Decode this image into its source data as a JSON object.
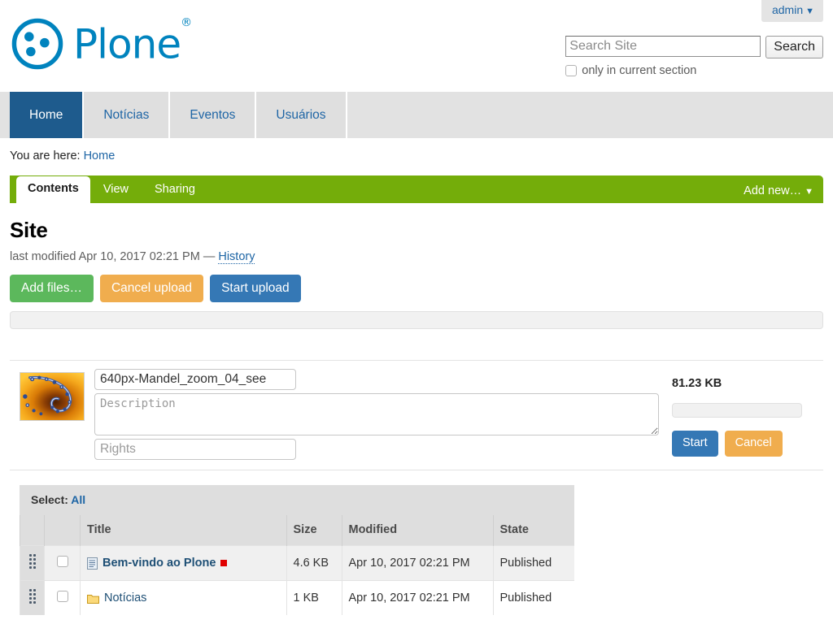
{
  "personaltools": {
    "user": "admin",
    "caret": "▼",
    "icon": "chevron-down-icon"
  },
  "logo": {
    "word": "Plone",
    "trademark": "®",
    "alt": "plone-logo"
  },
  "search": {
    "placeholder": "Search Site",
    "value": "",
    "button_label": "Search",
    "option_label": "only in current section",
    "option_checked": false
  },
  "globalnav": {
    "items": [
      {
        "label": "Home",
        "selected": true
      },
      {
        "label": "Notícias",
        "selected": false
      },
      {
        "label": "Eventos",
        "selected": false
      },
      {
        "label": "Usuários",
        "selected": false
      }
    ]
  },
  "breadcrumbs": {
    "prefix": "You are here:",
    "items": [
      {
        "label": "Home"
      }
    ]
  },
  "content_tabs": {
    "items": [
      {
        "label": "Contents",
        "selected": true
      },
      {
        "label": "View",
        "selected": false
      },
      {
        "label": "Sharing",
        "selected": false
      }
    ],
    "add_new_label": "Add new…",
    "add_new_caret": "▼"
  },
  "document": {
    "title": "Site",
    "byline_prefix": "last modified",
    "byline_date": "Apr 10, 2017 02:21 PM",
    "byline_sep": "—",
    "history_link": "History"
  },
  "upload": {
    "add_files_label": "Add files…",
    "cancel_upload_label": "Cancel upload",
    "start_upload_label": "Start upload",
    "overall_progress_percent": 0,
    "queue": [
      {
        "preview": "mandelbrot-fractal-thumbnail",
        "title_value": "640px-Mandel_zoom_04_see",
        "description_placeholder": "Description",
        "description_value": "",
        "rights_placeholder": "Rights",
        "rights_value": "",
        "size": "81.23 KB",
        "progress_percent": 0,
        "start_label": "Start",
        "cancel_label": "Cancel"
      }
    ]
  },
  "listing": {
    "select_prefix": "Select:",
    "select_all_label": "All",
    "columns": [
      "",
      "",
      "Title",
      "Size",
      "Modified",
      "State"
    ],
    "rows": [
      {
        "icon": "document-icon",
        "title": "Bem-vindo ao Plone",
        "bold": true,
        "marker": "red-square-icon",
        "size": "4.6 KB",
        "modified": "Apr 10, 2017 02:21 PM",
        "state": "Published"
      },
      {
        "icon": "folder-icon",
        "title": "Notícias",
        "bold": false,
        "marker": "",
        "size": "1 KB",
        "modified": "Apr 10, 2017 02:21 PM",
        "state": "Published"
      }
    ]
  },
  "colors": {
    "plone_blue": "#0083be",
    "nav_active": "#1e5b8d",
    "tabbar_green": "#74ad0a",
    "link_blue": "#1e65a5",
    "btn_green": "#5cb85c",
    "btn_orange": "#f0ad4e",
    "btn_blue": "#3578b5",
    "marker_red": "#e00000"
  }
}
